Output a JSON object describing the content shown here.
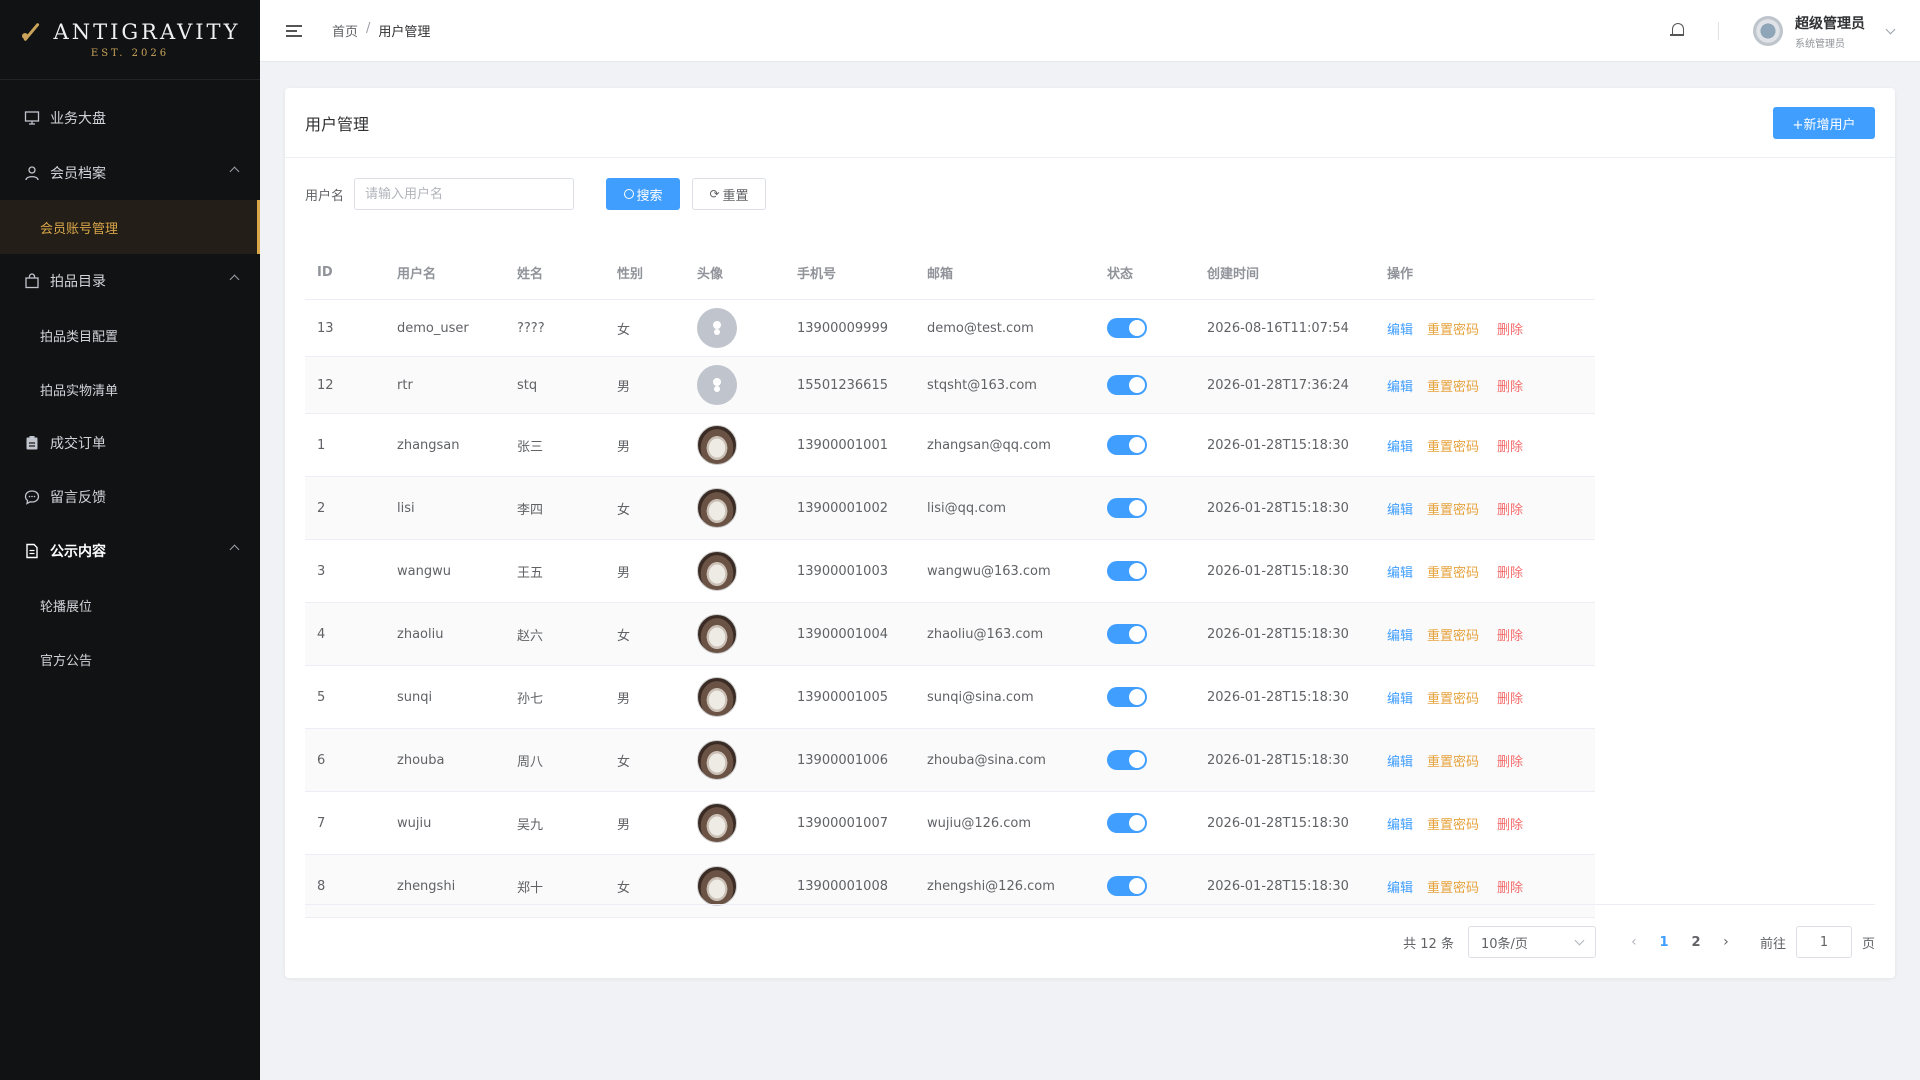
{
  "brand": {
    "name": "ANTIGRAVITY",
    "tagline": "EST. 2026"
  },
  "sidebar": {
    "items": [
      {
        "label": "业务大盘",
        "icon": "dashboard-icon"
      },
      {
        "label": "会员档案",
        "icon": "user-icon",
        "expanded": true,
        "children": [
          {
            "label": "会员账号管理",
            "active": true
          }
        ]
      },
      {
        "label": "拍品目录",
        "icon": "bag-icon",
        "expanded": true,
        "children": [
          {
            "label": "拍品类目配置"
          },
          {
            "label": "拍品实物清单"
          }
        ]
      },
      {
        "label": "成交订单",
        "icon": "clipboard-icon"
      },
      {
        "label": "留言反馈",
        "icon": "chat-icon"
      },
      {
        "label": "公示内容",
        "icon": "document-icon",
        "expanded": true,
        "children": [
          {
            "label": "轮播展位"
          },
          {
            "label": "官方公告"
          }
        ]
      }
    ]
  },
  "header": {
    "breadcrumb": {
      "home": "首页",
      "separator": "/",
      "current": "用户管理"
    },
    "user": {
      "name": "超级管理员",
      "role": "系统管理员"
    }
  },
  "card": {
    "title": "用户管理",
    "add_label": "+新增用户"
  },
  "filter": {
    "label": "用户名",
    "placeholder": "请输入用户名",
    "search_label": "搜索",
    "reset_label": "重置"
  },
  "table": {
    "columns": [
      "ID",
      "用户名",
      "姓名",
      "性别",
      "头像",
      "手机号",
      "邮箱",
      "状态",
      "创建时间",
      "操作"
    ],
    "ops": {
      "edit": "编辑",
      "reset": "重置密码",
      "delete": "删除"
    },
    "rows": [
      {
        "id": "13",
        "username": "demo_user",
        "name": "????",
        "gender": "女",
        "avatar": "placeholder",
        "phone": "13900009999",
        "email": "demo@test.com",
        "enabled": true,
        "created": "2026-08-16T11:07:54"
      },
      {
        "id": "12",
        "username": "rtr",
        "name": "stq",
        "gender": "男",
        "avatar": "placeholder",
        "phone": "15501236615",
        "email": "stqsht@163.com",
        "enabled": true,
        "created": "2026-01-28T17:36:24"
      },
      {
        "id": "1",
        "username": "zhangsan",
        "name": "张三",
        "gender": "男",
        "avatar": "photo",
        "phone": "13900001001",
        "email": "zhangsan@qq.com",
        "enabled": true,
        "created": "2026-01-28T15:18:30"
      },
      {
        "id": "2",
        "username": "lisi",
        "name": "李四",
        "gender": "女",
        "avatar": "photo",
        "phone": "13900001002",
        "email": "lisi@qq.com",
        "enabled": true,
        "created": "2026-01-28T15:18:30"
      },
      {
        "id": "3",
        "username": "wangwu",
        "name": "王五",
        "gender": "男",
        "avatar": "photo",
        "phone": "13900001003",
        "email": "wangwu@163.com",
        "enabled": true,
        "created": "2026-01-28T15:18:30"
      },
      {
        "id": "4",
        "username": "zhaoliu",
        "name": "赵六",
        "gender": "女",
        "avatar": "photo",
        "phone": "13900001004",
        "email": "zhaoliu@163.com",
        "enabled": true,
        "created": "2026-01-28T15:18:30"
      },
      {
        "id": "5",
        "username": "sunqi",
        "name": "孙七",
        "gender": "男",
        "avatar": "photo",
        "phone": "13900001005",
        "email": "sunqi@sina.com",
        "enabled": true,
        "created": "2026-01-28T15:18:30"
      },
      {
        "id": "6",
        "username": "zhouba",
        "name": "周八",
        "gender": "女",
        "avatar": "photo",
        "phone": "13900001006",
        "email": "zhouba@sina.com",
        "enabled": true,
        "created": "2026-01-28T15:18:30"
      },
      {
        "id": "7",
        "username": "wujiu",
        "name": "吴九",
        "gender": "男",
        "avatar": "photo",
        "phone": "13900001007",
        "email": "wujiu@126.com",
        "enabled": true,
        "created": "2026-01-28T15:18:30"
      },
      {
        "id": "8",
        "username": "zhengshi",
        "name": "郑十",
        "gender": "女",
        "avatar": "photo",
        "phone": "13900001008",
        "email": "zhengshi@126.com",
        "enabled": true,
        "created": "2026-01-28T15:18:30"
      }
    ]
  },
  "pagination": {
    "total_text": "共 12 条",
    "page_size": "10条/页",
    "pages": [
      "1",
      "2"
    ],
    "current": "1",
    "goto_label": "前往",
    "goto_value": "1",
    "page_suffix": "页"
  },
  "colors": {
    "primary": "#409eff",
    "warning": "#e6a23c",
    "danger": "#f56c6c",
    "sidebar_bg": "#111214",
    "sidebar_active": "#d9a64a"
  }
}
